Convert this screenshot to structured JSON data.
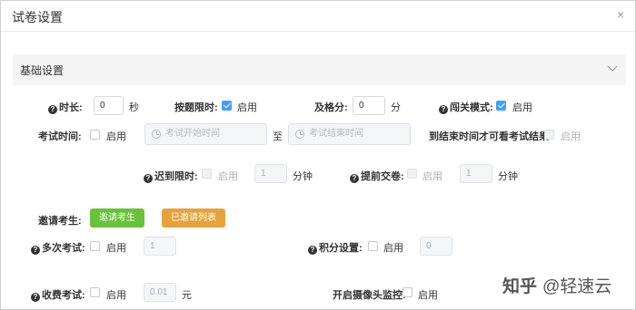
{
  "dialog": {
    "title": "试卷设置",
    "close": "×"
  },
  "section": {
    "label": "基础设置"
  },
  "enable": "启用",
  "row1": {
    "duration_label": "时长:",
    "duration_value": "0",
    "duration_unit": "秒",
    "per_question_label": "按题限时:",
    "pass_label": "及格分:",
    "pass_value": "0",
    "pass_unit": "分",
    "level_label": "闯关模式:"
  },
  "row2": {
    "exam_time_label": "考试时间:",
    "start_placeholder": "考试开始时间",
    "to": "至",
    "end_placeholder": "考试结束时间",
    "view_result_label": "到结束时间才可看考试结果:"
  },
  "row3": {
    "late_label": "迟到限时:",
    "late_value": "1",
    "late_unit": "分钟",
    "early_label": "提前交卷:",
    "early_value": "1",
    "early_unit": "分钟"
  },
  "row4": {
    "invite_label": "邀请考生:",
    "invite_button": "邀请考生",
    "invited_list_button": "已邀请列表"
  },
  "row5": {
    "multi_label": "多次考试:",
    "multi_value": "1",
    "points_label": "积分设置:",
    "points_value": "0"
  },
  "row6": {
    "fee_label": "收费考试:",
    "fee_value": "0.01",
    "fee_unit": "元",
    "camera_label": "开启摄像头监控:"
  },
  "watermark": {
    "logo": "知乎",
    "text": "@轻速云"
  },
  "colors": {
    "checked": "#409eff",
    "green": "#67c23a",
    "orange": "#e6a23c"
  }
}
